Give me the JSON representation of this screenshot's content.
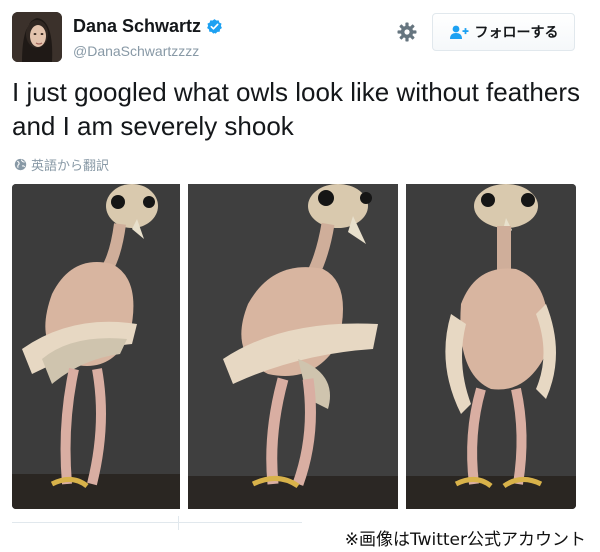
{
  "user": {
    "display_name": "Dana Schwartz",
    "handle": "@DanaSchwartzzzz",
    "verified": true
  },
  "follow_label": "フォローする",
  "tweet": {
    "text": "I just googled what owls look like without feathers and I am severely shook",
    "translate_label": "英語から翻訳"
  },
  "photos": [
    {
      "icon": "featherless-owl-image"
    },
    {
      "icon": "featherless-owl-image"
    },
    {
      "icon": "featherless-owl-image"
    }
  ],
  "credit": "※画像はTwitter公式アカウント",
  "colors": {
    "verified": "#1da1f2",
    "muted": "#8899a6",
    "photo_bg": "#3a3a3a",
    "follow_icon": "#1da1f2"
  }
}
